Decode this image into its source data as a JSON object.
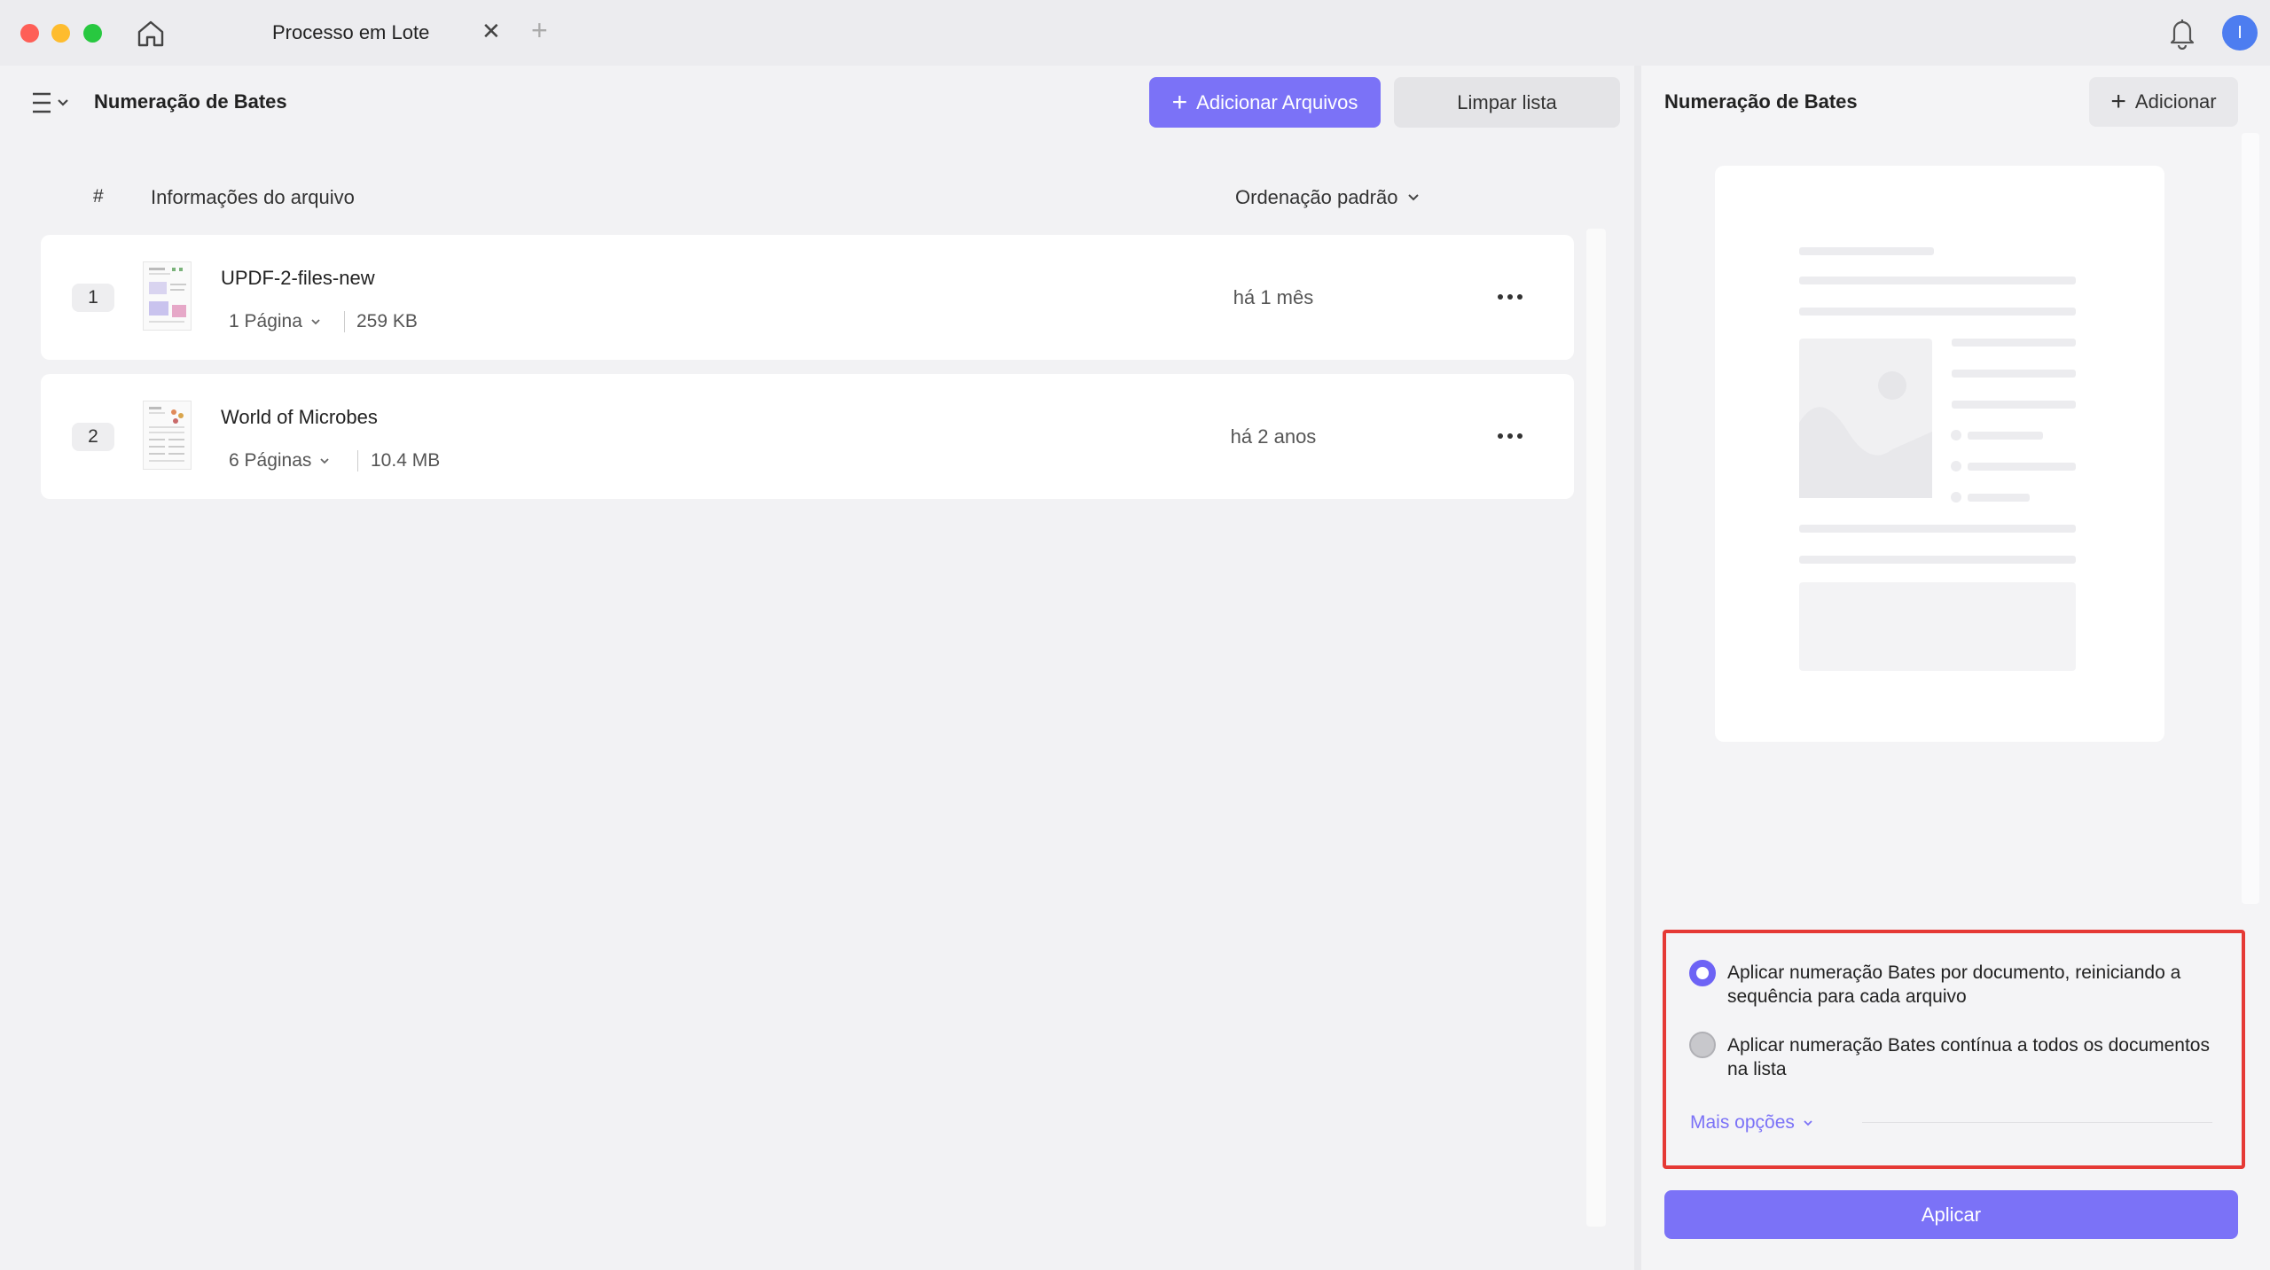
{
  "window": {
    "tab_title": "Processo em Lote",
    "tab_close": "✕",
    "tab_add": "+",
    "avatar_initial": "I"
  },
  "left_panel": {
    "title": "Numeração de Bates",
    "add_files_label": "Adicionar Arquivos",
    "clear_list_label": "Limpar lista",
    "columns": {
      "number": "#",
      "info": "Informações do arquivo",
      "sort": "Ordenação padrão"
    },
    "files": [
      {
        "index": "1",
        "name": "UPDF-2-files-new",
        "pages": "1 Página",
        "size": "259 KB",
        "date": "há 1 mês"
      },
      {
        "index": "2",
        "name": "World of Microbes",
        "pages": "6 Páginas",
        "size": "10.4 MB",
        "date": "há 2 anos"
      }
    ]
  },
  "right_panel": {
    "title": "Numeração de Bates",
    "add_label": "Adicionar",
    "options": [
      {
        "label": "Aplicar numeração Bates por documento, reiniciando a sequência para cada arquivo",
        "selected": true
      },
      {
        "label": "Aplicar numeração Bates contínua a todos os documentos na lista",
        "selected": false
      }
    ],
    "more_options_label": "Mais opções",
    "apply_label": "Aplicar"
  },
  "colors": {
    "accent": "#7b72f7",
    "highlight_border": "#e53935"
  },
  "icons": [
    "home-icon",
    "bell-icon",
    "menu-icon",
    "chevron-down-icon",
    "more-icon",
    "plus-icon"
  ]
}
